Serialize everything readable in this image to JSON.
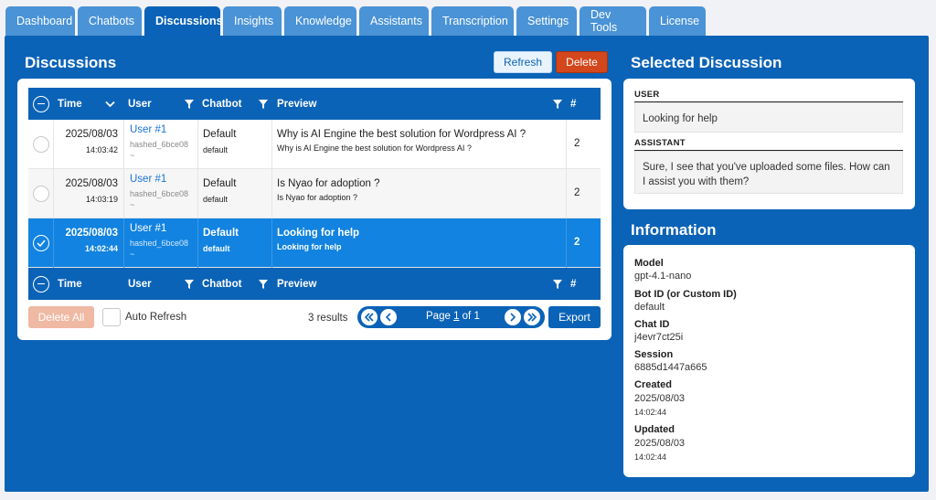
{
  "tabs": [
    "Dashboard",
    "Chatbots",
    "Discussions",
    "Insights",
    "Knowledge",
    "Assistants",
    "Transcription",
    "Settings",
    "Dev Tools",
    "License"
  ],
  "active_tab": "Discussions",
  "discussions": {
    "title": "Discussions",
    "refresh_label": "Refresh",
    "delete_label": "Delete",
    "columns": {
      "time": "Time",
      "user": "User",
      "chatbot": "Chatbot",
      "preview": "Preview",
      "count": "#"
    },
    "rows": [
      {
        "date": "2025/08/03",
        "time": "14:03:42",
        "user": "User #1",
        "hash": "hashed_6bce08",
        "tilde": "~",
        "bot": "Default",
        "bot_id": "default",
        "preview": "Why is AI Engine the best solution for Wordpress AI ?",
        "preview_sub": "Why is AI Engine the best solution for Wordpress AI ?",
        "count": "2"
      },
      {
        "date": "2025/08/03",
        "time": "14:03:19",
        "user": "User #1",
        "hash": "hashed_6bce08",
        "tilde": "~",
        "bot": "Default",
        "bot_id": "default",
        "preview": "Is Nyao for adoption ?",
        "preview_sub": "Is Nyao for adoption ?",
        "count": "2"
      },
      {
        "date": "2025/08/03",
        "time": "14:02:44",
        "user": "User #1",
        "hash": "hashed_6bce08",
        "tilde": "~",
        "bot": "Default",
        "bot_id": "default",
        "preview": "Looking for help",
        "preview_sub": "Looking for help",
        "count": "2"
      }
    ],
    "delete_all_label": "Delete All",
    "auto_refresh_label": "Auto Refresh",
    "results_text": "3 results",
    "page_prefix": "Page ",
    "page_current": "1",
    "page_suffix": " of 1",
    "export_label": "Export"
  },
  "selected": {
    "title": "Selected Discussion",
    "messages": [
      {
        "role": "USER",
        "text": "Looking for help"
      },
      {
        "role": "ASSISTANT",
        "text": "Sure, I see that you've uploaded some files. How can I assist you with them?"
      }
    ]
  },
  "info": {
    "title": "Information",
    "model_label": "Model",
    "model": "gpt-4.1-nano",
    "botid_label": "Bot ID (or Custom ID)",
    "botid": "default",
    "chatid_label": "Chat ID",
    "chatid": "j4evr7ct25i",
    "session_label": "Session",
    "session": "6885d1447a665",
    "created_label": "Created",
    "created_date": "2025/08/03",
    "created_time": "14:02:44",
    "updated_label": "Updated",
    "updated_date": "2025/08/03",
    "updated_time": "14:02:44"
  },
  "colors": {
    "primary": "#0b63b7",
    "selected_row": "#1283e0",
    "delete": "#d2471b"
  }
}
